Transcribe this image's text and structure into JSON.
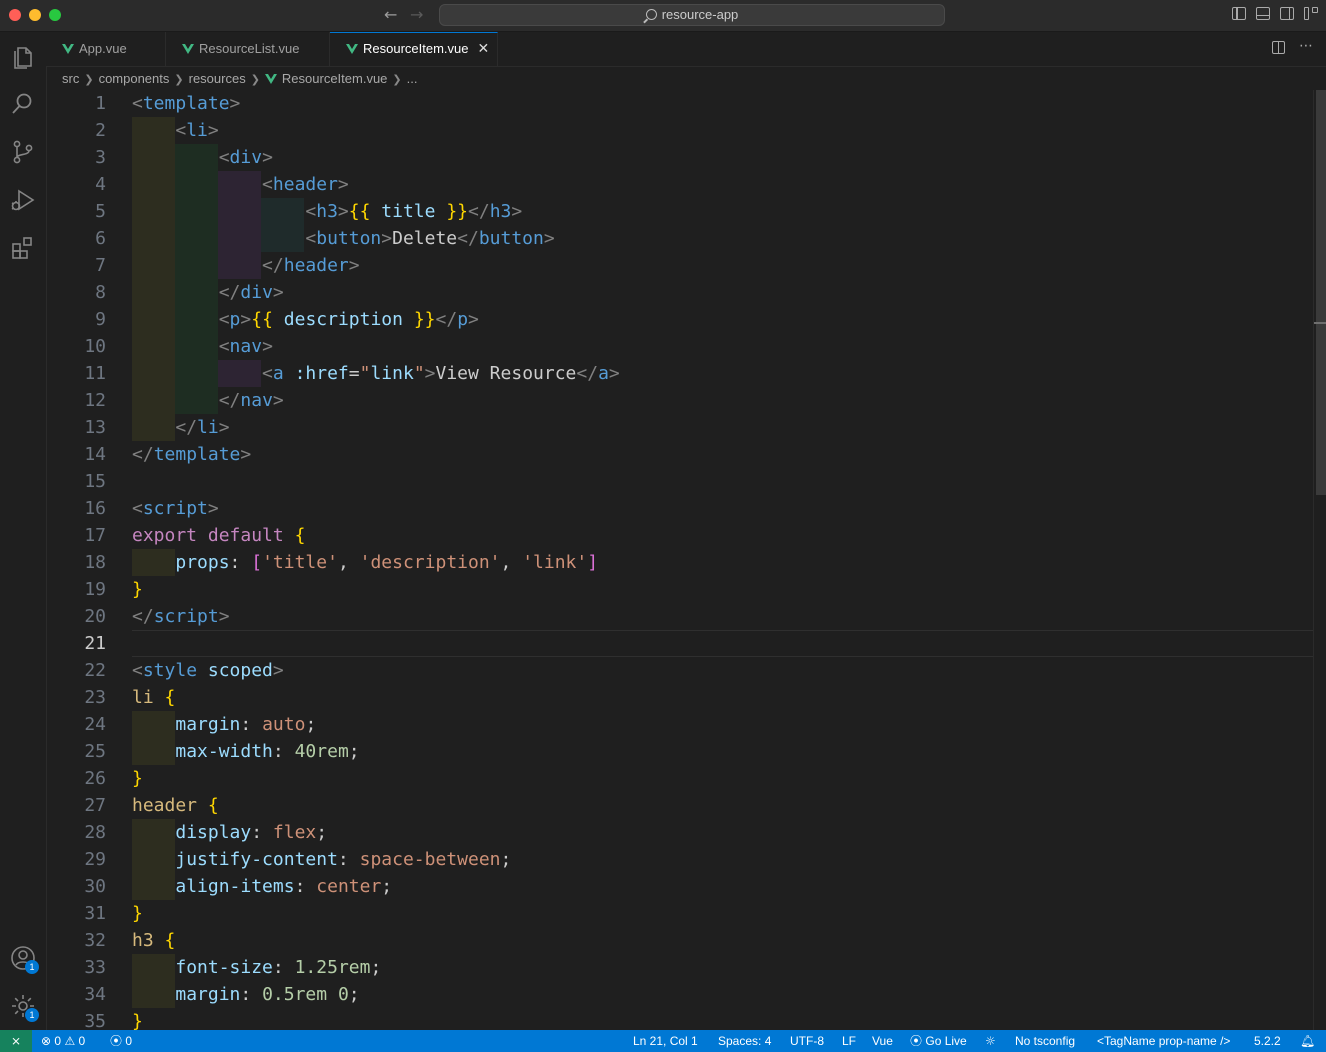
{
  "window": {
    "title": "resource-app"
  },
  "tabs": [
    {
      "label": "App.vue",
      "active": false
    },
    {
      "label": "ResourceList.vue",
      "active": false
    },
    {
      "label": "ResourceItem.vue",
      "active": true
    }
  ],
  "tab_close_glyph": "✕",
  "breadcrumb": {
    "parts": [
      "src",
      "components",
      "resources"
    ],
    "file": "ResourceItem.vue",
    "tail": "..."
  },
  "editor": {
    "current_line": 21,
    "line_numbers": [
      "1",
      "2",
      "3",
      "4",
      "5",
      "6",
      "7",
      "8",
      "9",
      "10",
      "11",
      "12",
      "13",
      "14",
      "15",
      "16",
      "17",
      "18",
      "19",
      "20",
      "21",
      "22",
      "23",
      "24",
      "25",
      "26",
      "27",
      "28",
      "29",
      "30",
      "31",
      "32",
      "33",
      "34",
      "35"
    ]
  },
  "activity_bar": {
    "items": [
      "explorer-icon",
      "search-icon",
      "source-control-icon",
      "run-debug-icon",
      "extensions-icon"
    ],
    "accounts_badge": "1",
    "settings_badge": "1"
  },
  "statusbar": {
    "remote_glyph": "⨯",
    "errors": "0",
    "warnings": "0",
    "ports": "0",
    "position": "Ln 21, Col 1",
    "spaces": "Spaces: 4",
    "encoding": "UTF-8",
    "eol": "LF",
    "language": "Vue",
    "golive": "Go Live",
    "tsconfig": "No tsconfig",
    "tagname": "<TagName prop-name />",
    "version": "5.2.2"
  }
}
